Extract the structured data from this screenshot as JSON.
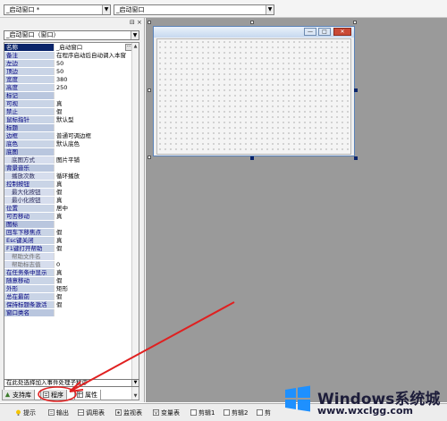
{
  "topbar": {
    "combo_left": "_启动窗口 *",
    "combo_right": "_启动窗口"
  },
  "panel": {
    "ctrl_pin": "⊟",
    "ctrl_close": "×",
    "object_combo": "_启动窗口（窗口）",
    "properties": [
      {
        "name": "名称",
        "value": "_启动窗口",
        "selected": true,
        "button": "···"
      },
      {
        "name": "备注",
        "value": "在程序启动后自动调入本窗"
      },
      {
        "name": "左边",
        "value": "50"
      },
      {
        "name": "顶边",
        "value": "50"
      },
      {
        "name": "宽度",
        "value": "380"
      },
      {
        "name": "高度",
        "value": "250"
      },
      {
        "name": "标记",
        "value": ""
      },
      {
        "name": "可视",
        "value": "真"
      },
      {
        "name": "禁止",
        "value": "假"
      },
      {
        "name": "鼠标指针",
        "value": "默认型"
      },
      {
        "name": "标题",
        "value": ""
      },
      {
        "name": "边框",
        "value": "普通可调边框"
      },
      {
        "name": "底色",
        "value": "默认底色"
      },
      {
        "name": "底图",
        "value": ""
      },
      {
        "name": "底图方式",
        "value": "图片平铺",
        "indent": true
      },
      {
        "name": "背景音乐",
        "value": ""
      },
      {
        "name": "播放次数",
        "value": "循环播放",
        "indent": true
      },
      {
        "name": "控制按钮",
        "value": "真"
      },
      {
        "name": "最大化按钮",
        "value": "假",
        "indent": true
      },
      {
        "name": "最小化按钮",
        "value": "真",
        "indent": true
      },
      {
        "name": "位置",
        "value": "居中"
      },
      {
        "name": "可否移动",
        "value": "真"
      },
      {
        "name": "图标",
        "value": ""
      },
      {
        "name": "回车下移焦点",
        "value": "假"
      },
      {
        "name": "Esc键关闭",
        "value": "真"
      },
      {
        "name": "F1键打开帮助",
        "value": "假"
      },
      {
        "name": "帮助文件名",
        "value": "",
        "indent": true,
        "dim": true
      },
      {
        "name": "帮助标志值",
        "value": "0",
        "indent": true,
        "dim": true
      },
      {
        "name": "在任务条中显示",
        "value": "真"
      },
      {
        "name": "随意移动",
        "value": "假"
      },
      {
        "name": "外形",
        "value": "矩形"
      },
      {
        "name": "总在最前",
        "value": "假"
      },
      {
        "name": "保持标题条激活",
        "value": "假"
      },
      {
        "name": "窗口类名",
        "value": ""
      }
    ],
    "event_combo": "在此处选择加入事件处理子程序",
    "tabs": [
      {
        "label": "支持库",
        "icon": "library-icon"
      },
      {
        "label": "程序",
        "icon": "program-icon"
      },
      {
        "label": "属性",
        "icon": "property-icon"
      }
    ]
  },
  "form": {
    "btn_min": "—",
    "btn_max": "□",
    "btn_close": "✕"
  },
  "bottom_tabs": [
    {
      "label": "提示",
      "icon": "tip-icon"
    },
    {
      "label": "输出",
      "icon": "output-icon"
    },
    {
      "label": "调用表",
      "icon": "callstack-icon"
    },
    {
      "label": "监视表",
      "icon": "watch-icon"
    },
    {
      "label": "变量表",
      "icon": "variable-icon"
    },
    {
      "label": "剪辑1",
      "icon": "clip-icon"
    },
    {
      "label": "剪辑2",
      "icon": "clip-icon"
    },
    {
      "label": "剪",
      "icon": "clip-icon"
    }
  ],
  "watermark": {
    "title": "Windows系统城",
    "subtitle": "www.wxclgg.com"
  },
  "colors": {
    "annotation": "#e02020",
    "selection": "#0a246a",
    "design_bg": "#9a9a9a"
  }
}
